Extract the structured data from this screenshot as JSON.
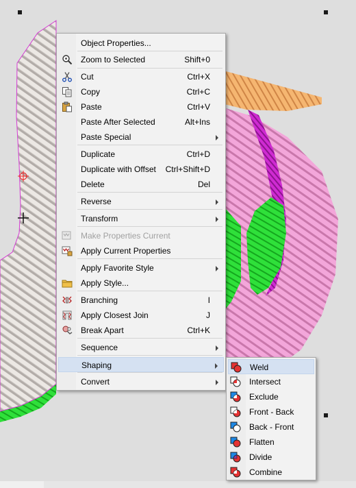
{
  "main_menu": {
    "items": [
      {
        "label": "Object Properties...",
        "shortcut": "",
        "icon": "none",
        "arrow": false,
        "disabled": false
      },
      {
        "label": "Zoom to Selected",
        "shortcut": "Shift+0",
        "icon": "zoom-icon",
        "arrow": false,
        "disabled": false
      },
      {
        "label": "Cut",
        "shortcut": "Ctrl+X",
        "icon": "scissors-icon",
        "arrow": false,
        "disabled": false
      },
      {
        "label": "Copy",
        "shortcut": "Ctrl+C",
        "icon": "copy-icon",
        "arrow": false,
        "disabled": false
      },
      {
        "label": "Paste",
        "shortcut": "Ctrl+V",
        "icon": "paste-icon",
        "arrow": false,
        "disabled": false
      },
      {
        "label": "Paste After Selected",
        "shortcut": "Alt+Ins",
        "icon": "none",
        "arrow": false,
        "disabled": false
      },
      {
        "label": "Paste Special",
        "shortcut": "",
        "icon": "none",
        "arrow": true,
        "disabled": false
      },
      {
        "label": "Duplicate",
        "shortcut": "Ctrl+D",
        "icon": "none",
        "arrow": false,
        "disabled": false
      },
      {
        "label": "Duplicate with Offset",
        "shortcut": "Ctrl+Shift+D",
        "icon": "none",
        "arrow": false,
        "disabled": false
      },
      {
        "label": "Delete",
        "shortcut": "Del",
        "icon": "none",
        "arrow": false,
        "disabled": false
      },
      {
        "label": "Reverse",
        "shortcut": "",
        "icon": "none",
        "arrow": true,
        "disabled": false
      },
      {
        "label": "Transform",
        "shortcut": "",
        "icon": "none",
        "arrow": true,
        "disabled": false
      },
      {
        "label": "Make Properties Current",
        "shortcut": "",
        "icon": "make-properties-icon",
        "arrow": false,
        "disabled": true
      },
      {
        "label": "Apply Current Properties",
        "shortcut": "",
        "icon": "apply-properties-icon",
        "arrow": false,
        "disabled": false
      },
      {
        "label": "Apply Favorite Style",
        "shortcut": "",
        "icon": "none",
        "arrow": true,
        "disabled": false
      },
      {
        "label": "Apply Style...",
        "shortcut": "",
        "icon": "folder-icon",
        "arrow": false,
        "disabled": false
      },
      {
        "label": "Branching",
        "shortcut": "I",
        "icon": "branching-icon",
        "arrow": false,
        "disabled": false
      },
      {
        "label": "Apply Closest Join",
        "shortcut": "J",
        "icon": "closest-join-icon",
        "arrow": false,
        "disabled": false
      },
      {
        "label": "Break Apart",
        "shortcut": "Ctrl+K",
        "icon": "break-apart-icon",
        "arrow": false,
        "disabled": false
      },
      {
        "label": "Sequence",
        "shortcut": "",
        "icon": "none",
        "arrow": true,
        "disabled": false
      },
      {
        "label": "Shaping",
        "shortcut": "",
        "icon": "none",
        "arrow": true,
        "disabled": false,
        "highlighted": true
      },
      {
        "label": "Convert",
        "shortcut": "",
        "icon": "none",
        "arrow": true,
        "disabled": false
      }
    ]
  },
  "shaping_submenu": {
    "items": [
      {
        "label": "Weld",
        "icon": "weld-icon",
        "highlighted": true
      },
      {
        "label": "Intersect",
        "icon": "intersect-icon"
      },
      {
        "label": "Exclude",
        "icon": "exclude-icon"
      },
      {
        "label": "Front - Back",
        "icon": "front-back-icon"
      },
      {
        "label": "Back - Front",
        "icon": "back-front-icon"
      },
      {
        "label": "Flatten",
        "icon": "flatten-icon"
      },
      {
        "label": "Divide",
        "icon": "divide-icon"
      },
      {
        "label": "Combine",
        "icon": "combine-icon"
      }
    ]
  },
  "colors": {
    "menu_bg": "#f2f2f2",
    "highlight": "#d5e1f2",
    "stitch_white": "#e8e4e0",
    "stitch_pink": "#ef98cf",
    "stitch_magenta": "#c424c8",
    "stitch_green": "#22d12e",
    "stitch_orange": "#f1a860"
  }
}
